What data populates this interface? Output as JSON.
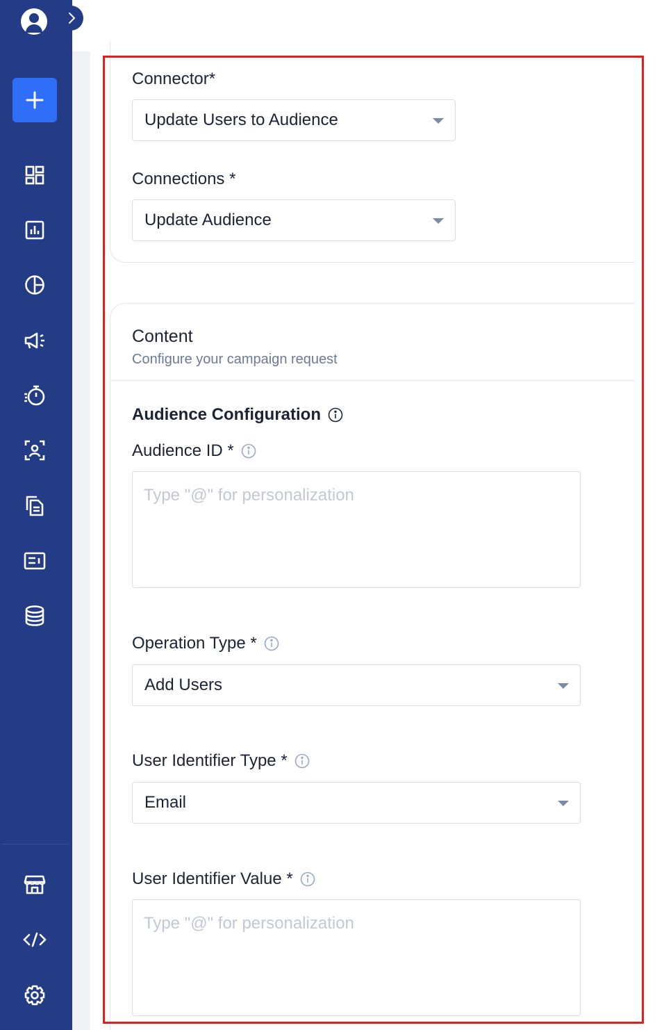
{
  "sidebar": {
    "items": [
      {
        "icon": "dashboard-icon"
      },
      {
        "icon": "analytics-icon"
      },
      {
        "icon": "segments-icon"
      },
      {
        "icon": "campaigns-icon"
      },
      {
        "icon": "journeys-icon"
      },
      {
        "icon": "users-icon"
      },
      {
        "icon": "templates-icon"
      },
      {
        "icon": "catalog-icon"
      },
      {
        "icon": "data-icon"
      },
      {
        "icon": "store-icon"
      },
      {
        "icon": "developer-icon"
      },
      {
        "icon": "settings-icon"
      }
    ]
  },
  "connector": {
    "label": "Connector*",
    "value": "Update Users to Audience"
  },
  "connections": {
    "label": "Connections *",
    "value": "Update Audience"
  },
  "content": {
    "title": "Content",
    "subtitle": "Configure your campaign request"
  },
  "audience_config": {
    "title": "Audience Configuration",
    "audience_id": {
      "label": "Audience ID *",
      "placeholder": "Type \"@\" for personalization"
    },
    "operation_type": {
      "label": "Operation Type *",
      "value": "Add Users"
    },
    "user_identifier_type": {
      "label": "User Identifier Type *",
      "value": "Email"
    },
    "user_identifier_value": {
      "label": "User Identifier Value *",
      "placeholder": "Type \"@\" for personalization"
    }
  },
  "colors": {
    "sidebar": "#243c85",
    "accent": "#2f6ef7",
    "highlight": "#e0201f"
  }
}
